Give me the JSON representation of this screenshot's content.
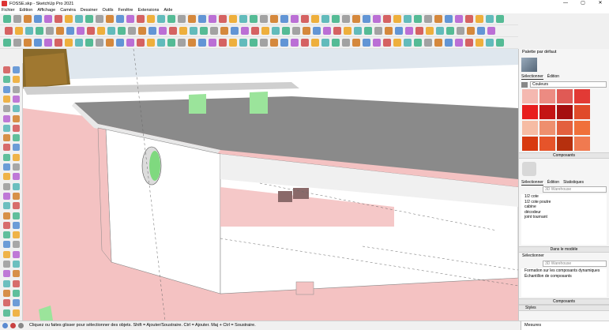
{
  "window": {
    "title": "FOSSE.skp - SketchUp Pro 2021",
    "controls": [
      "—",
      "▢",
      "✕"
    ]
  },
  "menu": [
    "Fichier",
    "Edition",
    "Affichage",
    "Caméra",
    "Dessiner",
    "Outils",
    "Fenêtre",
    "Extensions",
    "Aide"
  ],
  "tray": {
    "title": "Palette par défaut",
    "materials": {
      "tabs": [
        "Sélectionner",
        "Édition"
      ],
      "dropdown": "Couleurs",
      "swatches": [
        "#f4b8b0",
        "#ec8b82",
        "#e05a55",
        "#e23a35",
        "#e81e1e",
        "#c41414",
        "#a50f0f",
        "#e04a2a",
        "#f6bca4",
        "#ee8f6e",
        "#e3603e",
        "#f0703a",
        "#d83a10",
        "#e6542a",
        "#b6300e",
        "#f07a50"
      ]
    },
    "components": {
      "title": "Composants",
      "tabs": [
        "Sélectionner",
        "Édition",
        "Statistiques"
      ],
      "search_placeholder": "3D Warehouse",
      "items": [
        "1/2 cote",
        "1/2 cote poutre",
        "cabine",
        "décodeur",
        "joint tournant"
      ],
      "in_model": "Dans le modèle",
      "select_label": "Sélectionner",
      "search2_placeholder": "3D Warehouse",
      "items2": [
        "Formation sur les composants dynamiques",
        "Échantillon de composants"
      ],
      "footer": "Composants"
    },
    "styles": "Styles"
  },
  "status": {
    "text": "Cliquez ou faites glisser pour sélectionner des objets. Shift = Ajouter/Soustraire. Ctrl = Ajouter. Maj + Ctrl = Soustraire.",
    "measure_label": "Mesures"
  },
  "colors": {
    "ground": "#f4c2c2",
    "ground_dark": "#e8a8a8",
    "surface_top": "#8a8a8a",
    "green": "#9be49b",
    "wall": "#ffffff",
    "sky": "#d8e4ec"
  }
}
